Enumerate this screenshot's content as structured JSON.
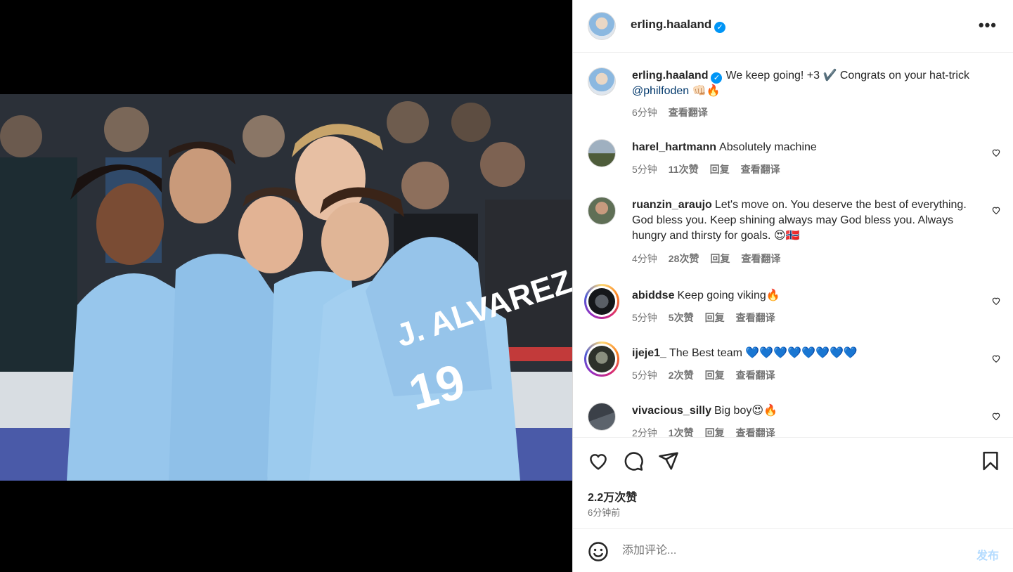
{
  "post": {
    "author": "erling.haaland",
    "caption_text": "We keep going! +3 ✔️ Congrats on your hat-trick ",
    "caption_mention": "@philfoden",
    "caption_emoji": "👊🏻🔥",
    "caption_time": "6分钟",
    "caption_translate": "查看翻译"
  },
  "comments": [
    {
      "user": "harel_hartmann",
      "text": "Absolutely machine",
      "time": "5分钟",
      "likes": "11次赞",
      "reply": "回复",
      "translate": "查看翻译"
    },
    {
      "user": "ruanzin_araujo",
      "text": "Let's move on. You deserve the best of everything. God bless you. Keep shining always may God bless you. Always hungry and thirsty for goals. 😍🇳🇴",
      "time": "4分钟",
      "likes": "28次赞",
      "reply": "回复",
      "translate": "查看翻译"
    },
    {
      "user": "abiddse",
      "text": "Keep going viking🔥",
      "time": "5分钟",
      "likes": "5次赞",
      "reply": "回复",
      "translate": "查看翻译"
    },
    {
      "user": "ijeje1_",
      "text": "The Best team 💙💙💙💙💙💙💙💙",
      "time": "5分钟",
      "likes": "2次赞",
      "reply": "回复",
      "translate": "查看翻译"
    },
    {
      "user": "vivacious_silly",
      "text": "Big boy😍🔥",
      "time": "2分钟",
      "likes": "1次赞",
      "reply": "回复",
      "translate": "查看翻译"
    }
  ],
  "actions": {
    "likes_count": "2.2万次赞",
    "posted_ago": "6分钟前"
  },
  "composer": {
    "placeholder": "添加评论...",
    "post_label": "发布"
  },
  "icons": {
    "verified": "verified-badge-icon",
    "more": "more-options-icon",
    "like": "heart-icon",
    "comment": "comment-icon",
    "share": "share-icon",
    "save": "bookmark-icon",
    "emoji": "emoji-icon"
  },
  "colors": {
    "verified_blue": "#0095f6",
    "link": "#00376b",
    "post_button_disabled": "#b3dbff",
    "muted": "#737373"
  }
}
